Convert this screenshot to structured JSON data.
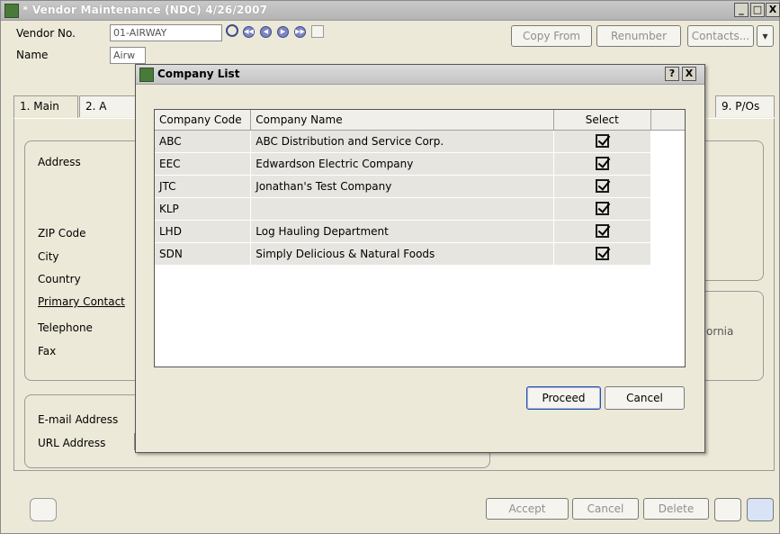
{
  "main_window": {
    "title": "* Vendor Maintenance (NDC) 4/26/2007",
    "min_label": "_",
    "max_label": "□",
    "close_label": "X"
  },
  "header": {
    "vendor_no_label": "Vendor No.",
    "vendor_no_value": "01-AIRWAY",
    "name_label": "Name",
    "name_value": "Airw",
    "copy_from": "Copy From",
    "renumber": "Renumber",
    "contacts": "Contacts...",
    "contacts_arrow": "▾",
    "nav": [
      "◀◀",
      "◀",
      "▶",
      "▶▶"
    ]
  },
  "tabs": [
    {
      "label": "1. Main"
    },
    {
      "label": "2. A"
    },
    {
      "label": "9. P/Os"
    }
  ],
  "form": {
    "address_label": "Address",
    "zip_label": "ZIP Code",
    "city_label": "City",
    "country_label": "Country",
    "primary_contact_label": "Primary Contact",
    "telephone_label": "Telephone",
    "fax_label": "Fax",
    "email_label": "E-mail Address",
    "url_label": "URL Address",
    "state_partial": "ornia"
  },
  "footer": {
    "accept": "Accept",
    "cancel": "Cancel",
    "delete": "Delete"
  },
  "dialog": {
    "title": "Company List",
    "help_label": "?",
    "close_label": "X",
    "columns": [
      "Company Code",
      "Company Name",
      "Select"
    ],
    "rows": [
      {
        "code": "ABC",
        "name": "ABC Distribution and Service Corp.",
        "selected": true
      },
      {
        "code": "EEC",
        "name": "Edwardson Electric Company",
        "selected": true
      },
      {
        "code": "JTC",
        "name": "Jonathan's Test Company",
        "selected": true
      },
      {
        "code": "KLP",
        "name": "",
        "selected": true
      },
      {
        "code": "LHD",
        "name": "Log Hauling Department",
        "selected": true
      },
      {
        "code": "SDN",
        "name": "Simply Delicious & Natural Foods",
        "selected": true
      }
    ],
    "proceed": "Proceed",
    "cancel": "Cancel"
  }
}
